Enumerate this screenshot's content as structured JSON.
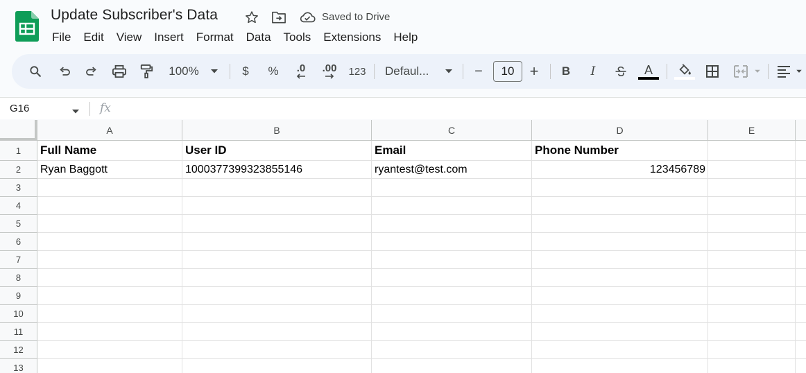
{
  "app": {
    "doc_title": "Update Subscriber's Data",
    "saved_status": "Saved to Drive",
    "brand_color": "#0f9d58"
  },
  "menu": [
    "File",
    "Edit",
    "View",
    "Insert",
    "Format",
    "Data",
    "Tools",
    "Extensions",
    "Help"
  ],
  "toolbar": {
    "zoom": "100%",
    "currency": "$",
    "percent": "%",
    "decrease_decimal": ".0",
    "increase_decimal": ".00",
    "number_format": "123",
    "font": "Defaul...",
    "font_size": "10",
    "minus": "−",
    "plus": "+",
    "bold": "B",
    "italic": "I",
    "text_color": "A"
  },
  "formula_bar": {
    "name_box": "G16",
    "fx": "fx"
  },
  "sheet": {
    "columns": [
      "A",
      "B",
      "C",
      "D",
      "E"
    ],
    "rows": [
      "1",
      "2",
      "3",
      "4",
      "5",
      "6",
      "7",
      "8",
      "9",
      "10",
      "11",
      "12",
      "13"
    ],
    "header": [
      "Full Name",
      "User ID",
      "Email",
      "Phone Number"
    ],
    "row2": [
      "Ryan Baggott",
      "100037739932385​5146",
      "ryantest@test.com",
      "123456789"
    ]
  }
}
